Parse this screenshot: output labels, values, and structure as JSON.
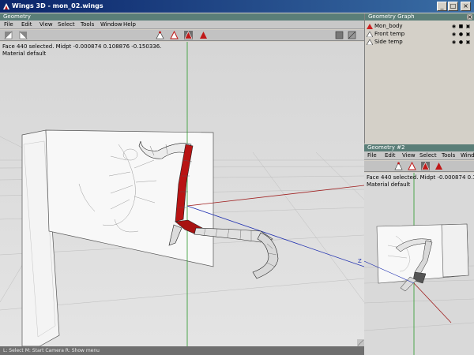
{
  "window": {
    "title": "Wings 3D - mon_02.wings",
    "min": "_",
    "max": "□",
    "close": "×"
  },
  "geometry": {
    "header": "Geometry",
    "menu": [
      "File",
      "Edit",
      "View",
      "Select",
      "Tools",
      "Window",
      "Help"
    ],
    "info_line1": "Face 440 selected. Midpt -0.000874 0.108876 -0.150336.",
    "info_line2": "Material default"
  },
  "status_bar": "L: Select   M: Start Camera   R: Show menu",
  "geometry_graph": {
    "header": "Geometry Graph",
    "objects": [
      {
        "name": "Mon_body",
        "color": "#cc2020"
      },
      {
        "name": "Front temp",
        "color": "#ffffff"
      },
      {
        "name": "Side temp",
        "color": "#ffffff"
      }
    ]
  },
  "geometry2": {
    "header": "Geometry #2",
    "menu": [
      "File",
      "Edit",
      "View",
      "Select",
      "Tools",
      "Windo"
    ],
    "info_line1": "Face 440 selected. Midpt -0.000874 0.10887",
    "info_line2": "Material default"
  },
  "axis_labels": {
    "x": "X",
    "z": "Z"
  },
  "colors": {
    "title_bar": "#0a246a",
    "panel_header": "#5a7e78",
    "selection": "#c01818",
    "viewport_bg": "#d9d9d9"
  }
}
